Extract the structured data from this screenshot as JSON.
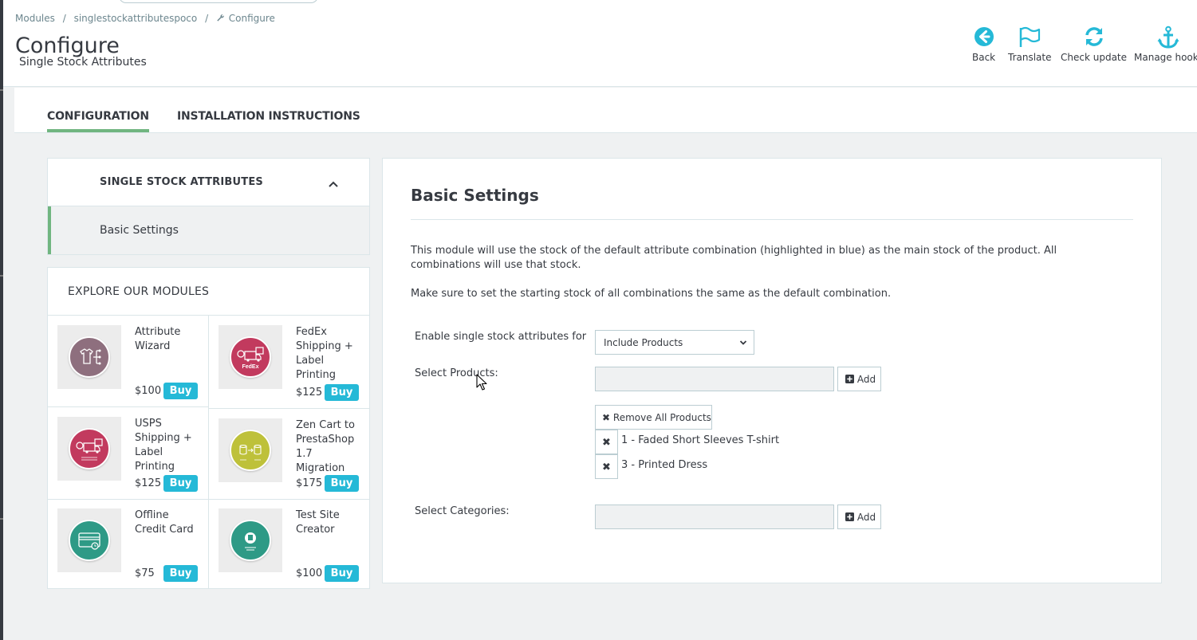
{
  "breadcrumb": {
    "items": [
      "Modules",
      "/",
      "singlestockattributespoco",
      "/",
      "Configure"
    ]
  },
  "header": {
    "title": "Configure",
    "subtitle": "Single Stock Attributes"
  },
  "toolbar": {
    "back": "Back",
    "translate": "Translate",
    "check_update": "Check update",
    "manage_hooks": "Manage hooks"
  },
  "tabs": {
    "configuration": "CONFIGURATION",
    "installation": "INSTALLATION INSTRUCTIONS"
  },
  "side_menu": {
    "title": "SINGLE STOCK ATTRIBUTES",
    "item": "Basic Settings"
  },
  "explore": {
    "title": "EXPLORE OUR MODULES",
    "buy_label": "Buy",
    "modules": [
      {
        "name": "Attribute Wizard",
        "price": "$100",
        "color": "#8e6f7e"
      },
      {
        "name": "FedEx Shipping + Label Printing",
        "price": "$125",
        "color": "#c23a5e"
      },
      {
        "name": "USPS Shipping + Label Printing",
        "price": "$125",
        "color": "#c23a5e"
      },
      {
        "name": "Zen Cart to PrestaShop 1.7 Migration",
        "price": "$175",
        "color": "#bec13a"
      },
      {
        "name": "Offline Credit Card",
        "price": "$75",
        "color": "#2e9a86"
      },
      {
        "name": "Test Site Creator",
        "price": "$100",
        "color": "#2e9a86"
      }
    ]
  },
  "main": {
    "title": "Basic Settings",
    "desc1": "This module will use the stock of the default attribute combination (highlighted in blue) as the main stock of the product. All combinations will use that stock.",
    "desc2": "Make sure to set the starting stock of all combinations the same as the default combination.",
    "enable_label": "Enable single stock attributes for",
    "enable_value": "Include Products",
    "select_products_label": "Select Products:",
    "add_label": "Add",
    "remove_all_label": "Remove All Products",
    "selected_products": [
      "1 - Faded Short Sleeves T-shirt",
      "3 - Printed Dress"
    ],
    "select_categories_label": "Select Categories:"
  },
  "colors": {
    "accent": "#25b9d7",
    "active_tab": "#70b580",
    "text": "#363a41"
  }
}
